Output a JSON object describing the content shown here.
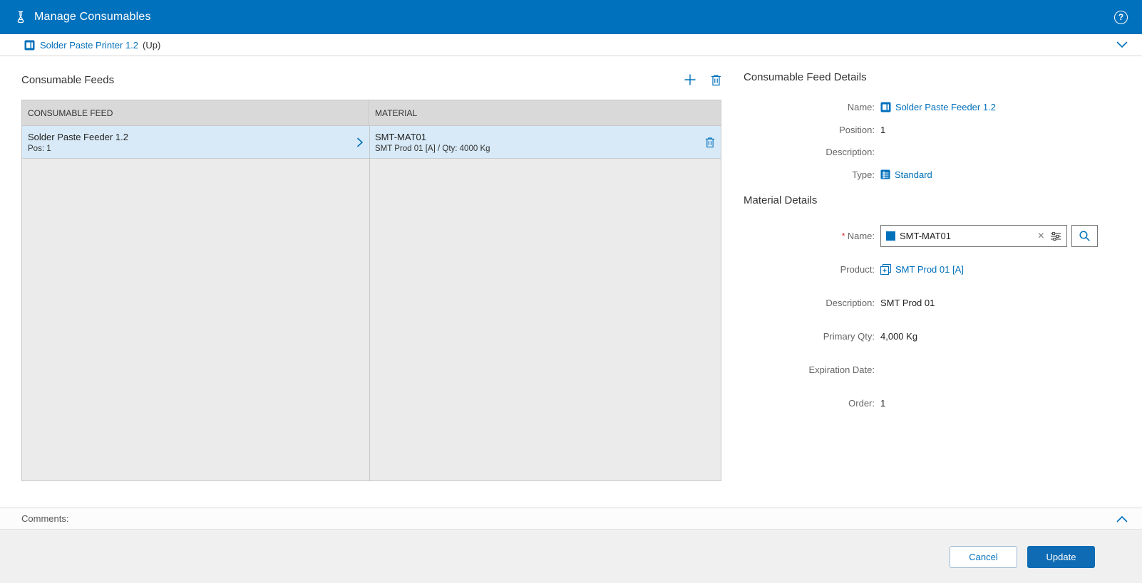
{
  "titlebar": {
    "title": "Manage Consumables"
  },
  "context_bar": {
    "resource": "Solder Paste Printer 1.2",
    "up": "(Up)"
  },
  "feeds": {
    "title": "Consumable Feeds",
    "columns": [
      "CONSUMABLE FEED",
      "MATERIAL"
    ],
    "rows": [
      {
        "feed": "Solder Paste Feeder 1.2",
        "feed_sub": "Pos: 1",
        "material": "SMT-MAT01",
        "material_sub": "SMT Prod 01 [A] / Qty: 4000 Kg"
      }
    ]
  },
  "feed_details": {
    "title": "Consumable Feed Details",
    "name_label": "Name:",
    "name": "Solder Paste Feeder 1.2",
    "position_label": "Position:",
    "position": "1",
    "description_label": "Description:",
    "description": "",
    "type_label": "Type:",
    "type": "Standard"
  },
  "material_details": {
    "title": "Material Details",
    "required_mark": "*",
    "name_label": "Name:",
    "name": "SMT-MAT01",
    "product_label": "Product:",
    "product": "SMT Prod 01 [A]",
    "description_label": "Description:",
    "description": "SMT Prod 01",
    "primary_qty_label": "Primary Qty:",
    "primary_qty": "4,000 Kg",
    "expiration_label": "Expiration Date:",
    "expiration": "",
    "order_label": "Order:",
    "order": "1"
  },
  "comments": {
    "label": "Comments:"
  },
  "footer": {
    "cancel": "Cancel",
    "update": "Update"
  },
  "icons": {
    "help": "?",
    "clear": "×"
  },
  "colors": {
    "header_blue": "#0071bc",
    "link_blue": "#0070bb",
    "selected_row": "#d8eaf7",
    "primary_button": "#0f6cb4"
  }
}
